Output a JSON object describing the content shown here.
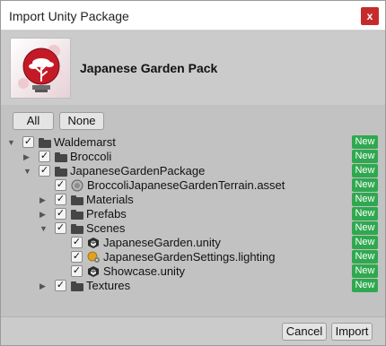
{
  "window": {
    "title": "Import Unity Package",
    "close_glyph": "x"
  },
  "package": {
    "name": "Japanese Garden Pack",
    "icon": "bonsai-tree-logo"
  },
  "selection": {
    "all_label": "All",
    "none_label": "None"
  },
  "tree": [
    {
      "name": "Waldemarst",
      "kind": "folder",
      "depth": 0,
      "expanded": true,
      "checked": true,
      "badge": "New"
    },
    {
      "name": "Broccoli",
      "kind": "folder",
      "depth": 1,
      "expanded": false,
      "checked": true,
      "badge": "New"
    },
    {
      "name": "JapaneseGardenPackage",
      "kind": "folder",
      "depth": 1,
      "expanded": true,
      "checked": true,
      "badge": "New"
    },
    {
      "name": "BroccoliJapaneseGardenTerrain.asset",
      "kind": "asset",
      "depth": 2,
      "checked": true,
      "badge": "New"
    },
    {
      "name": "Materials",
      "kind": "folder",
      "depth": 2,
      "expanded": false,
      "checked": true,
      "badge": "New"
    },
    {
      "name": "Prefabs",
      "kind": "folder",
      "depth": 2,
      "expanded": false,
      "checked": true,
      "badge": "New"
    },
    {
      "name": "Scenes",
      "kind": "folder",
      "depth": 2,
      "expanded": true,
      "checked": true,
      "badge": "New"
    },
    {
      "name": "JapaneseGarden.unity",
      "kind": "scene",
      "depth": 3,
      "checked": true,
      "badge": "New"
    },
    {
      "name": "JapaneseGardenSettings.lighting",
      "kind": "lighting",
      "depth": 3,
      "checked": true,
      "badge": "New"
    },
    {
      "name": "Showcase.unity",
      "kind": "scene",
      "depth": 3,
      "checked": true,
      "badge": "New"
    },
    {
      "name": "Textures",
      "kind": "folder",
      "depth": 2,
      "expanded": false,
      "checked": true,
      "badge": "New"
    }
  ],
  "footer": {
    "cancel_label": "Cancel",
    "import_label": "Import"
  }
}
